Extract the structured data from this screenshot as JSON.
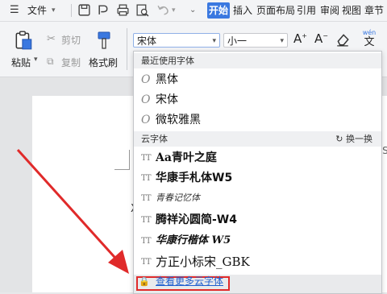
{
  "menubar": {
    "file_label": "文件",
    "tabs": [
      {
        "label": "开始",
        "active": true
      },
      {
        "label": "插入",
        "active": false
      },
      {
        "label": "页面布局",
        "active": false
      },
      {
        "label": "引用",
        "active": false
      },
      {
        "label": "审阅",
        "active": false
      },
      {
        "label": "视图",
        "active": false
      },
      {
        "label": "章节",
        "active": false
      }
    ]
  },
  "ribbon": {
    "paste_label": "粘贴",
    "cut_label": "剪切",
    "copy_label": "复制",
    "format_painter_label": "格式刷",
    "font_name": "宋体",
    "font_size": "小一",
    "wen_label": "wén"
  },
  "document": {
    "side_text": "WPS"
  },
  "font_dropdown": {
    "recent_header": "最近使用字体",
    "recent_fonts": [
      "黑体",
      "宋体",
      "微软雅黑"
    ],
    "cloud_header": "云字体",
    "refresh_label": "换一换",
    "cloud_fonts": [
      "Aa青叶之庭",
      "华康手札体W5",
      "青春记忆体",
      "腾祥沁圆简-W4",
      "华康行楷体 W5",
      "方正小标宋_GBK"
    ],
    "more_link": "查看更多云字体"
  },
  "colors": {
    "accent": "#3a78e0",
    "highlight": "#e02a2a",
    "link": "#1f5fcf"
  }
}
